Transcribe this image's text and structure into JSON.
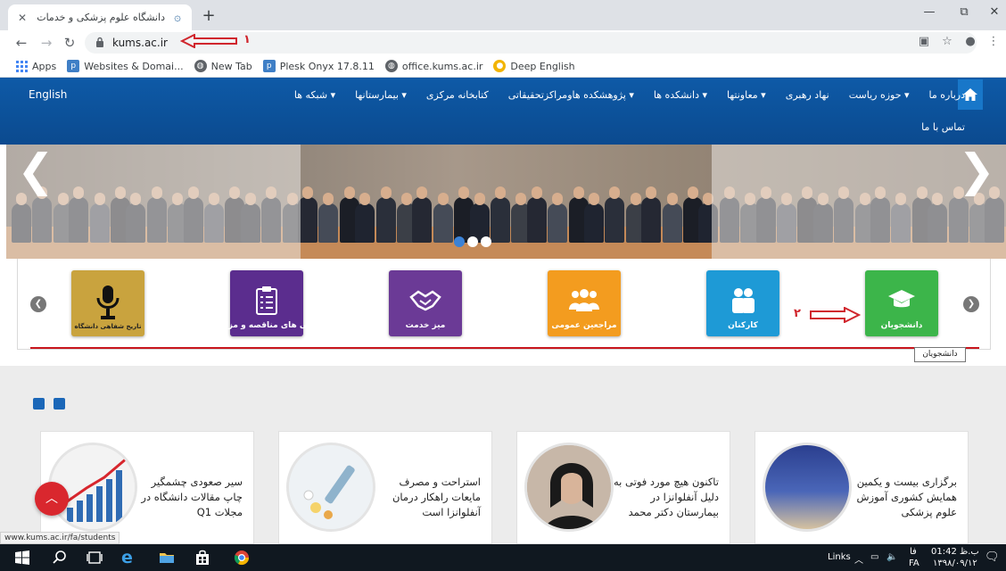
{
  "browser": {
    "tab_title": "دانشگاه علوم پزشکی و خدمات بهدا...",
    "new_tab": "+",
    "url": "kums.ac.ir",
    "status_url": "www.kums.ac.ir/fa/students"
  },
  "bookmarks": [
    {
      "label": "Apps"
    },
    {
      "label": "Websites & Domai..."
    },
    {
      "label": "New Tab"
    },
    {
      "label": "Plesk Onyx 17.8.11"
    },
    {
      "label": "office.kums.ac.ir"
    },
    {
      "label": "Deep English"
    }
  ],
  "annotations": {
    "marker_1": "۱",
    "marker_2": "۲"
  },
  "site_nav": {
    "english": "English",
    "items": [
      {
        "label": "درباره ما"
      },
      {
        "label": "حوزه ریاست ▾"
      },
      {
        "label": "نهاد رهبری"
      },
      {
        "label": "معاونتها ▾"
      },
      {
        "label": "دانشکده ها ▾"
      },
      {
        "label": "پژوهشکده هاومراکزتحقیقاتی ▾"
      },
      {
        "label": "کتابخانه مرکزی"
      },
      {
        "label": "بیمارستانها ▾"
      },
      {
        "label": "شبکه ها ▾"
      }
    ],
    "contact": "تماس با ما"
  },
  "tiles": [
    {
      "label": "دانشجویان",
      "color": "#3cb54a"
    },
    {
      "label": "کارکنان",
      "color": "#1e9ad6"
    },
    {
      "label": "مراجعین عمومی",
      "color": "#f39c1f"
    },
    {
      "label": "میز خدمت",
      "color": "#6b3a96"
    },
    {
      "label": "آگهی های مناقصه و مزایده",
      "color": "#5b2d8e"
    },
    {
      "label": "تاریخ شفاهی دانشگاه",
      "color": "#c9a33e"
    }
  ],
  "tooltip": "دانشجویان",
  "news": [
    {
      "text": "برگزاری بیست و یکمین همایش کشوری آموزش علوم پزشکی"
    },
    {
      "text": "تاکنون هیچ مورد فوتی به دلیل آنفلوانزا در بیمارستان دکتر محمد"
    },
    {
      "text": "استراحت و مصرف مایعات راهکار درمان آنفلوانزا است"
    },
    {
      "text": "سیر صعودی چشمگیر چاپ مقالات دانشگاه در مجلات Q1"
    }
  ],
  "taskbar": {
    "links": "Links",
    "lang_fa": "فا",
    "lang_code": "FA",
    "time": "01:42 ب.ظ",
    "date": "۱۳۹۸/۰۹/۱۲"
  },
  "colors": {
    "nav_blue": "#0e5aa7",
    "accent_red": "#c8161d"
  }
}
